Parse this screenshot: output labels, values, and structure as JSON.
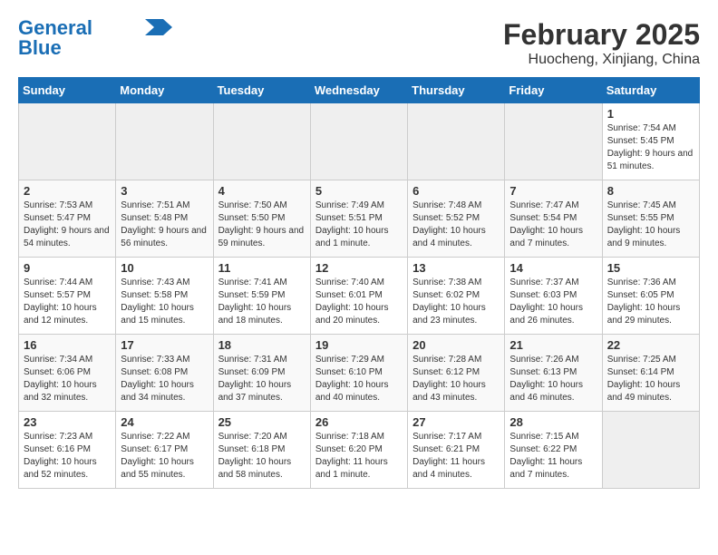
{
  "header": {
    "logo_line1": "General",
    "logo_line2": "Blue",
    "title": "February 2025",
    "subtitle": "Huocheng, Xinjiang, China"
  },
  "days_of_week": [
    "Sunday",
    "Monday",
    "Tuesday",
    "Wednesday",
    "Thursday",
    "Friday",
    "Saturday"
  ],
  "weeks": [
    [
      {
        "day": "",
        "info": ""
      },
      {
        "day": "",
        "info": ""
      },
      {
        "day": "",
        "info": ""
      },
      {
        "day": "",
        "info": ""
      },
      {
        "day": "",
        "info": ""
      },
      {
        "day": "",
        "info": ""
      },
      {
        "day": "1",
        "info": "Sunrise: 7:54 AM\nSunset: 5:45 PM\nDaylight: 9 hours and 51 minutes."
      }
    ],
    [
      {
        "day": "2",
        "info": "Sunrise: 7:53 AM\nSunset: 5:47 PM\nDaylight: 9 hours and 54 minutes."
      },
      {
        "day": "3",
        "info": "Sunrise: 7:51 AM\nSunset: 5:48 PM\nDaylight: 9 hours and 56 minutes."
      },
      {
        "day": "4",
        "info": "Sunrise: 7:50 AM\nSunset: 5:50 PM\nDaylight: 9 hours and 59 minutes."
      },
      {
        "day": "5",
        "info": "Sunrise: 7:49 AM\nSunset: 5:51 PM\nDaylight: 10 hours and 1 minute."
      },
      {
        "day": "6",
        "info": "Sunrise: 7:48 AM\nSunset: 5:52 PM\nDaylight: 10 hours and 4 minutes."
      },
      {
        "day": "7",
        "info": "Sunrise: 7:47 AM\nSunset: 5:54 PM\nDaylight: 10 hours and 7 minutes."
      },
      {
        "day": "8",
        "info": "Sunrise: 7:45 AM\nSunset: 5:55 PM\nDaylight: 10 hours and 9 minutes."
      }
    ],
    [
      {
        "day": "9",
        "info": "Sunrise: 7:44 AM\nSunset: 5:57 PM\nDaylight: 10 hours and 12 minutes."
      },
      {
        "day": "10",
        "info": "Sunrise: 7:43 AM\nSunset: 5:58 PM\nDaylight: 10 hours and 15 minutes."
      },
      {
        "day": "11",
        "info": "Sunrise: 7:41 AM\nSunset: 5:59 PM\nDaylight: 10 hours and 18 minutes."
      },
      {
        "day": "12",
        "info": "Sunrise: 7:40 AM\nSunset: 6:01 PM\nDaylight: 10 hours and 20 minutes."
      },
      {
        "day": "13",
        "info": "Sunrise: 7:38 AM\nSunset: 6:02 PM\nDaylight: 10 hours and 23 minutes."
      },
      {
        "day": "14",
        "info": "Sunrise: 7:37 AM\nSunset: 6:03 PM\nDaylight: 10 hours and 26 minutes."
      },
      {
        "day": "15",
        "info": "Sunrise: 7:36 AM\nSunset: 6:05 PM\nDaylight: 10 hours and 29 minutes."
      }
    ],
    [
      {
        "day": "16",
        "info": "Sunrise: 7:34 AM\nSunset: 6:06 PM\nDaylight: 10 hours and 32 minutes."
      },
      {
        "day": "17",
        "info": "Sunrise: 7:33 AM\nSunset: 6:08 PM\nDaylight: 10 hours and 34 minutes."
      },
      {
        "day": "18",
        "info": "Sunrise: 7:31 AM\nSunset: 6:09 PM\nDaylight: 10 hours and 37 minutes."
      },
      {
        "day": "19",
        "info": "Sunrise: 7:29 AM\nSunset: 6:10 PM\nDaylight: 10 hours and 40 minutes."
      },
      {
        "day": "20",
        "info": "Sunrise: 7:28 AM\nSunset: 6:12 PM\nDaylight: 10 hours and 43 minutes."
      },
      {
        "day": "21",
        "info": "Sunrise: 7:26 AM\nSunset: 6:13 PM\nDaylight: 10 hours and 46 minutes."
      },
      {
        "day": "22",
        "info": "Sunrise: 7:25 AM\nSunset: 6:14 PM\nDaylight: 10 hours and 49 minutes."
      }
    ],
    [
      {
        "day": "23",
        "info": "Sunrise: 7:23 AM\nSunset: 6:16 PM\nDaylight: 10 hours and 52 minutes."
      },
      {
        "day": "24",
        "info": "Sunrise: 7:22 AM\nSunset: 6:17 PM\nDaylight: 10 hours and 55 minutes."
      },
      {
        "day": "25",
        "info": "Sunrise: 7:20 AM\nSunset: 6:18 PM\nDaylight: 10 hours and 58 minutes."
      },
      {
        "day": "26",
        "info": "Sunrise: 7:18 AM\nSunset: 6:20 PM\nDaylight: 11 hours and 1 minute."
      },
      {
        "day": "27",
        "info": "Sunrise: 7:17 AM\nSunset: 6:21 PM\nDaylight: 11 hours and 4 minutes."
      },
      {
        "day": "28",
        "info": "Sunrise: 7:15 AM\nSunset: 6:22 PM\nDaylight: 11 hours and 7 minutes."
      },
      {
        "day": "",
        "info": ""
      }
    ]
  ]
}
